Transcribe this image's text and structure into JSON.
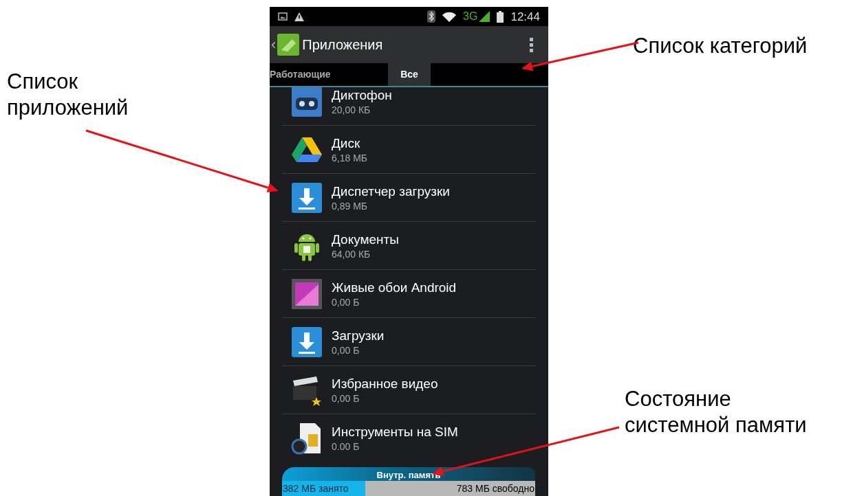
{
  "annotations": {
    "categories": "Список категорий",
    "apps": "Список приложений",
    "memory": "Состояние системной памяти"
  },
  "status_bar": {
    "network": "3G",
    "time": "12:44"
  },
  "action_bar": {
    "back": "‹",
    "title": "Приложения"
  },
  "tabs": [
    {
      "label": "Работающие",
      "selected": false
    },
    {
      "label": "Все",
      "selected": true
    }
  ],
  "apps": [
    {
      "name": "Диктофон",
      "size": "20,00 КБ",
      "kind": "recorder"
    },
    {
      "name": "Диск",
      "size": "6,18 МБ",
      "kind": "drive"
    },
    {
      "name": "Диспетчер загрузки",
      "size": "0,89 МБ",
      "kind": "download"
    },
    {
      "name": "Документы",
      "size": "64,00 КБ",
      "kind": "android"
    },
    {
      "name": "Живые обои Android",
      "size": "0,00 Б",
      "kind": "wallpaper"
    },
    {
      "name": "Загрузки",
      "size": "0,00 Б",
      "kind": "download"
    },
    {
      "name": "Избранное видео",
      "size": "0,00 Б",
      "kind": "video"
    },
    {
      "name": "Инструменты на SIM",
      "size": "0.00 Б",
      "kind": "sim"
    }
  ],
  "memory": {
    "label": "Внутр. память",
    "used": "382 МБ занято",
    "free": "783 МБ свободно",
    "level": 0.33
  }
}
